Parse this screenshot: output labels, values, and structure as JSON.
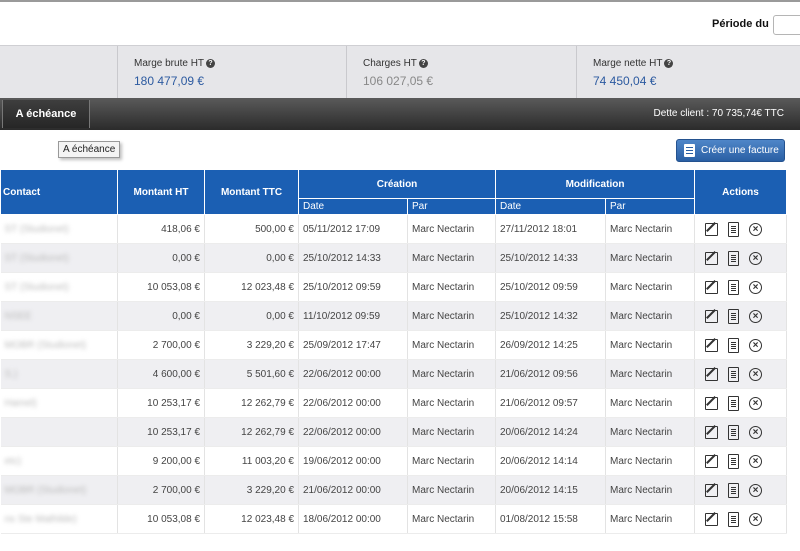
{
  "header": {
    "periode_label": "Période du",
    "periode_value": ""
  },
  "stats": [
    {
      "label": "Marge brute HT",
      "value": "180 477,09 €"
    },
    {
      "label": "Charges HT",
      "value": "106 027,05 €"
    },
    {
      "label": "Marge nette HT",
      "value": "74 450,04 €"
    }
  ],
  "nav": {
    "active_tab": "A échéance",
    "debt": "Dette client : 70 735,74€ TTC"
  },
  "tooltip": "A échéance",
  "create_button": "Créer une facture",
  "table": {
    "headers": {
      "contact": "Contact",
      "montant_ht": "Montant HT",
      "montant_ttc": "Montant TTC",
      "creation": "Création",
      "modification": "Modification",
      "actions": "Actions",
      "date": "Date",
      "par": "Par"
    },
    "rows": [
      {
        "contact": "ST (Studionet)",
        "ht": "418,06 €",
        "ttc": "500,00 €",
        "c_date": "05/11/2012 17:09",
        "c_par": "Marc Nectarin",
        "m_date": "27/11/2012 18:01",
        "m_par": "Marc Nectarin"
      },
      {
        "contact": "ST (Studionet)",
        "ht": "0,00 €",
        "ttc": "0,00 €",
        "c_date": "25/10/2012 14:33",
        "c_par": "Marc Nectarin",
        "m_date": "25/10/2012 14:33",
        "m_par": "Marc Nectarin"
      },
      {
        "contact": "ST (Studionet)",
        "ht": "10 053,08 €",
        "ttc": "12 023,48 €",
        "c_date": "25/10/2012 09:59",
        "c_par": "Marc Nectarin",
        "m_date": "25/10/2012 09:59",
        "m_par": "Marc Nectarin"
      },
      {
        "contact": "NSEE",
        "ht": "0,00 €",
        "ttc": "0,00 €",
        "c_date": "11/10/2012 09:59",
        "c_par": "Marc Nectarin",
        "m_date": "25/10/2012 14:32",
        "m_par": "Marc Nectarin"
      },
      {
        "contact": "MOBR (Studionet)",
        "ht": "2 700,00 €",
        "ttc": "3 229,20 €",
        "c_date": "25/09/2012 17:47",
        "c_par": "Marc Nectarin",
        "m_date": "26/09/2012 14:25",
        "m_par": "Marc Nectarin"
      },
      {
        "contact": "S.)",
        "ht": "4 600,00 €",
        "ttc": "5 501,60 €",
        "c_date": "22/06/2012 00:00",
        "c_par": "Marc Nectarin",
        "m_date": "21/06/2012 09:56",
        "m_par": "Marc Nectarin"
      },
      {
        "contact": "Hamel)",
        "ht": "10 253,17 €",
        "ttc": "12 262,79 €",
        "c_date": "22/06/2012 00:00",
        "c_par": "Marc Nectarin",
        "m_date": "21/06/2012 09:57",
        "m_par": "Marc Nectarin"
      },
      {
        "contact": "",
        "ht": "10 253,17 €",
        "ttc": "12 262,79 €",
        "c_date": "22/06/2012 00:00",
        "c_par": "Marc Nectarin",
        "m_date": "20/06/2012 14:24",
        "m_par": "Marc Nectarin"
      },
      {
        "contact": "etc)",
        "ht": "9 200,00 €",
        "ttc": "11 003,20 €",
        "c_date": "19/06/2012 00:00",
        "c_par": "Marc Nectarin",
        "m_date": "20/06/2012 14:14",
        "m_par": "Marc Nectarin"
      },
      {
        "contact": "MOBR (Studionet)",
        "ht": "2 700,00 €",
        "ttc": "3 229,20 €",
        "c_date": "21/06/2012 00:00",
        "c_par": "Marc Nectarin",
        "m_date": "20/06/2012 14:15",
        "m_par": "Marc Nectarin"
      },
      {
        "contact": "ns Ste Mathilde)",
        "ht": "10 053,08 €",
        "ttc": "12 023,48 €",
        "c_date": "18/06/2012 00:00",
        "c_par": "Marc Nectarin",
        "m_date": "01/08/2012 15:58",
        "m_par": "Marc Nectarin"
      }
    ]
  }
}
